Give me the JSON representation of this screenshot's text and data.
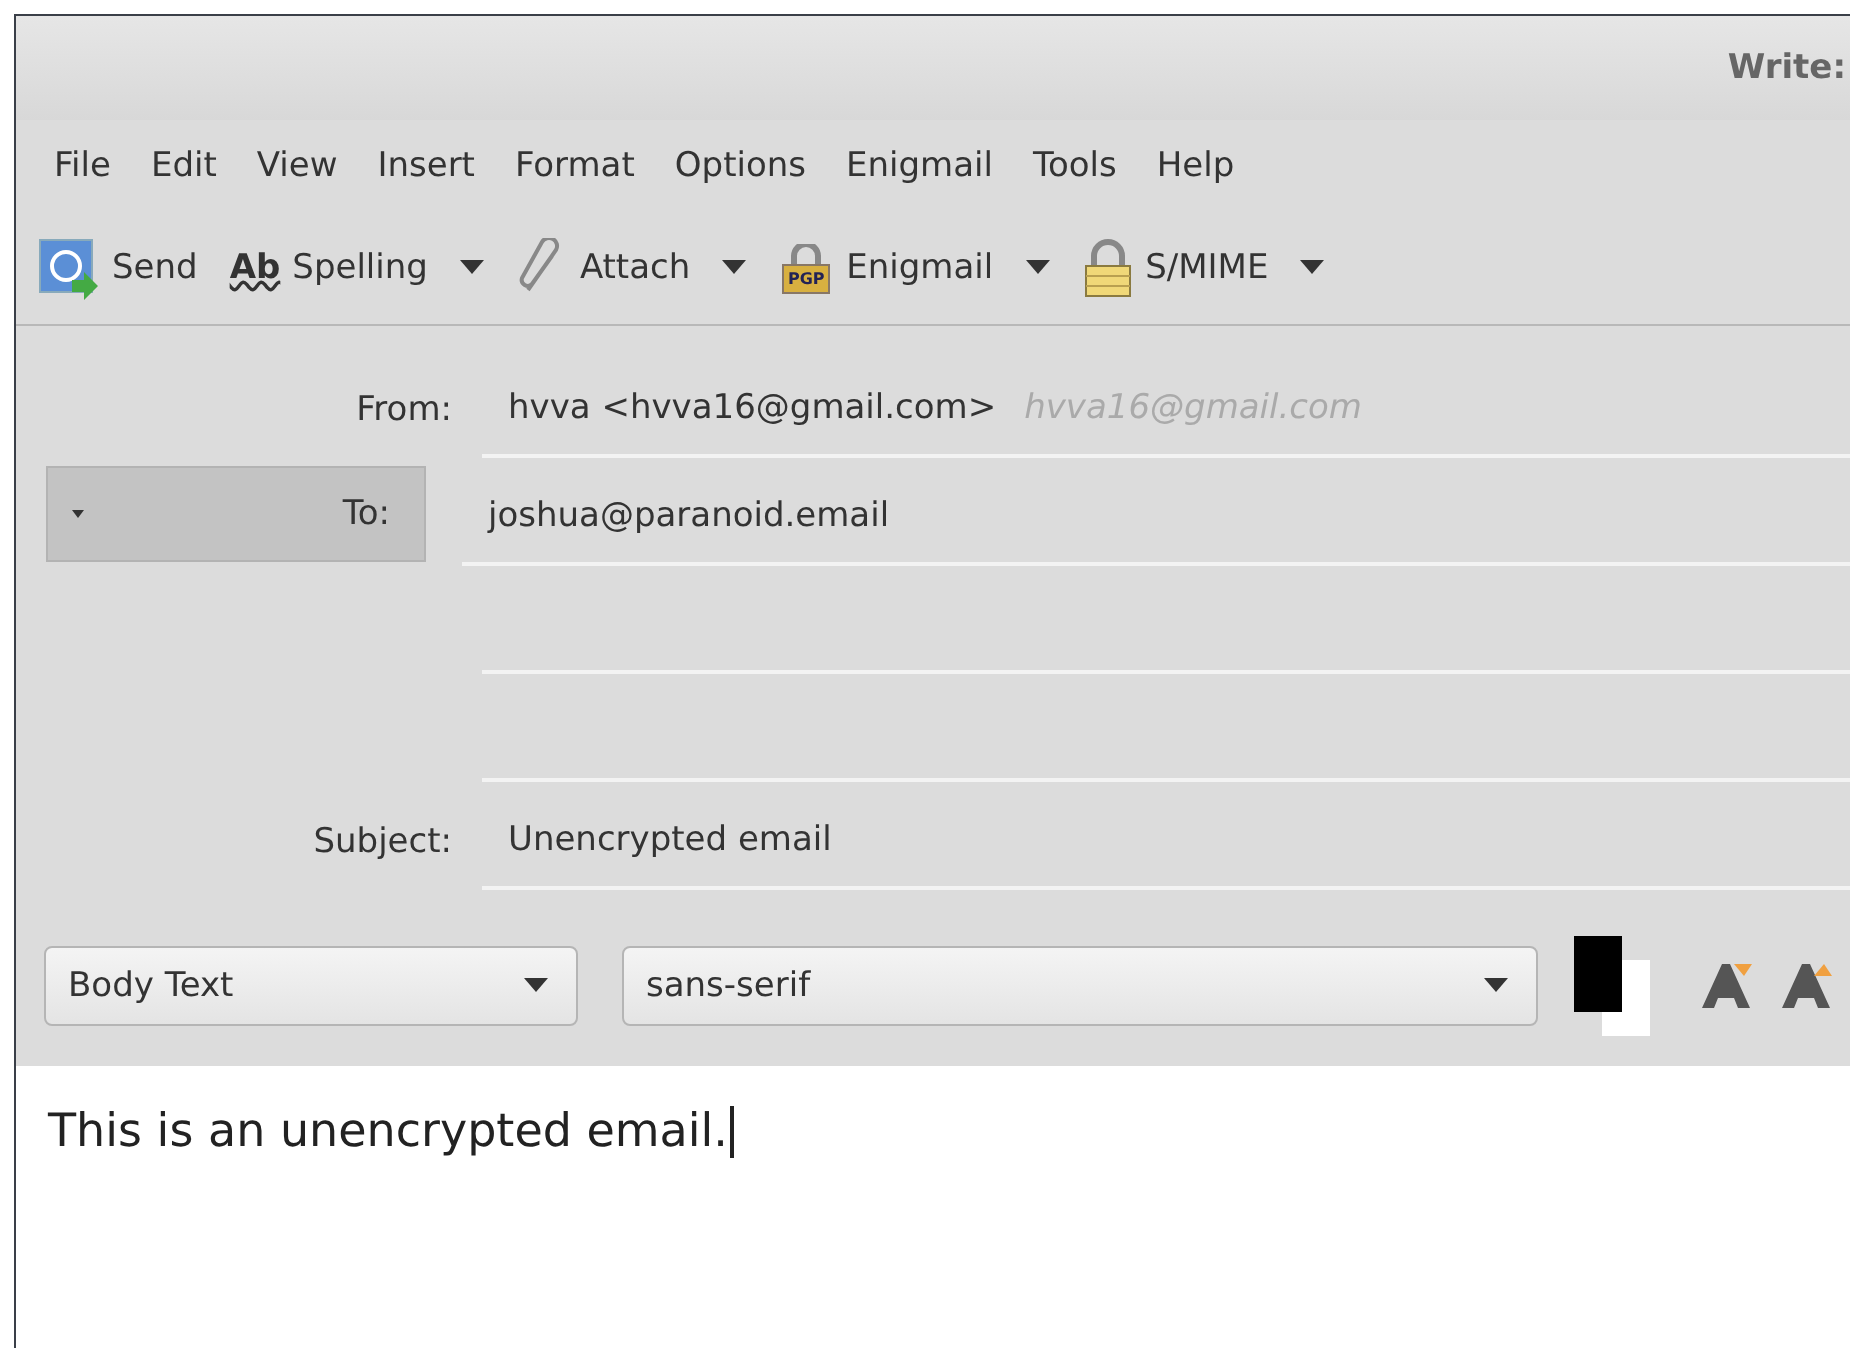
{
  "window": {
    "title": "Write:"
  },
  "menu": [
    {
      "label": "File"
    },
    {
      "label": "Edit"
    },
    {
      "label": "View"
    },
    {
      "label": "Insert"
    },
    {
      "label": "Format"
    },
    {
      "label": "Options"
    },
    {
      "label": "Enigmail"
    },
    {
      "label": "Tools"
    },
    {
      "label": "Help"
    }
  ],
  "toolbar": [
    {
      "kind": "send",
      "label": "Send",
      "dropdown": false
    },
    {
      "kind": "spelling",
      "label": "Spelling",
      "icon_text": "Ab",
      "dropdown": true
    },
    {
      "kind": "attach",
      "label": "Attach",
      "dropdown": true
    },
    {
      "kind": "enigmail",
      "label": "Enigmail",
      "icon_text": "PGP",
      "dropdown": true
    },
    {
      "kind": "smime",
      "label": "S/MIME",
      "dropdown": true
    }
  ],
  "header_fields": [
    {
      "kind": "from",
      "label": "From:",
      "value": "hvva <hvva16@gmail.com>",
      "hint": "hvva16@gmail.com"
    },
    {
      "kind": "recipient",
      "label": "To:",
      "value": "joshua@paranoid.email"
    },
    {
      "kind": "empty"
    },
    {
      "kind": "empty"
    },
    {
      "kind": "subject",
      "label": "Subject:",
      "value": "Unencrypted email"
    }
  ],
  "format_bar": {
    "paragraph_style": "Body Text",
    "font": "sans-serif"
  },
  "body": {
    "text": "This is an unencrypted email."
  }
}
